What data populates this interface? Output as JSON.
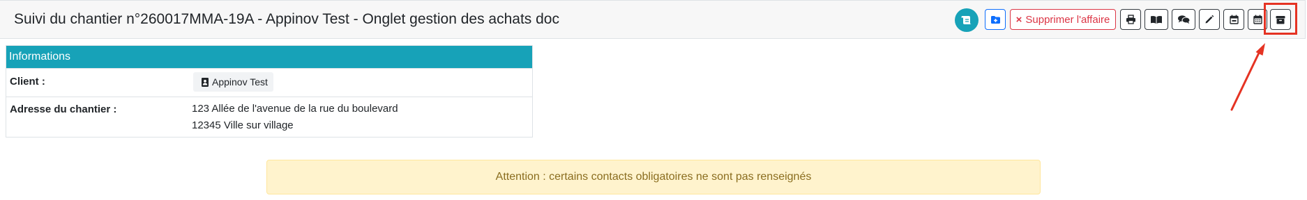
{
  "header": {
    "title": "Suivi du chantier n°260017MMA-19A - Appinov Test - Onglet gestion des achats doc"
  },
  "toolbar": {
    "buttons": [
      {
        "name": "scroll-button",
        "icon": "scroll-icon"
      },
      {
        "name": "add-folder-button",
        "icon": "folder-plus-icon"
      },
      {
        "name": "delete-affair-button",
        "icon": "close-icon",
        "label": "Supprimer l'affaire"
      },
      {
        "name": "print-button",
        "icon": "printer-icon"
      },
      {
        "name": "book-button",
        "icon": "book-open-icon"
      },
      {
        "name": "comments-button",
        "icon": "comments-icon"
      },
      {
        "name": "edit-button",
        "icon": "pencil-icon"
      },
      {
        "name": "calendar-button",
        "icon": "calendar-icon"
      },
      {
        "name": "calendar-grid-button",
        "icon": "calendar-days-icon"
      },
      {
        "name": "archive-button",
        "icon": "archive-box-icon"
      }
    ],
    "delete_label": "Supprimer l'affaire",
    "delete_x": "×"
  },
  "info": {
    "heading": "Informations",
    "client_label": "Client :",
    "client_value": "Appinov Test",
    "address_label": "Adresse du chantier :",
    "address_line1": "123 Allée de l'avenue de la rue du boulevard",
    "address_line2": "12345 Ville sur village"
  },
  "alert": {
    "text": "Attention : certains contacts obligatoires ne sont pas renseignés"
  },
  "colors": {
    "accent": "#17a2b8",
    "danger": "#dc3545",
    "annotation": "#e53323",
    "warning_bg": "#fff3cd"
  }
}
